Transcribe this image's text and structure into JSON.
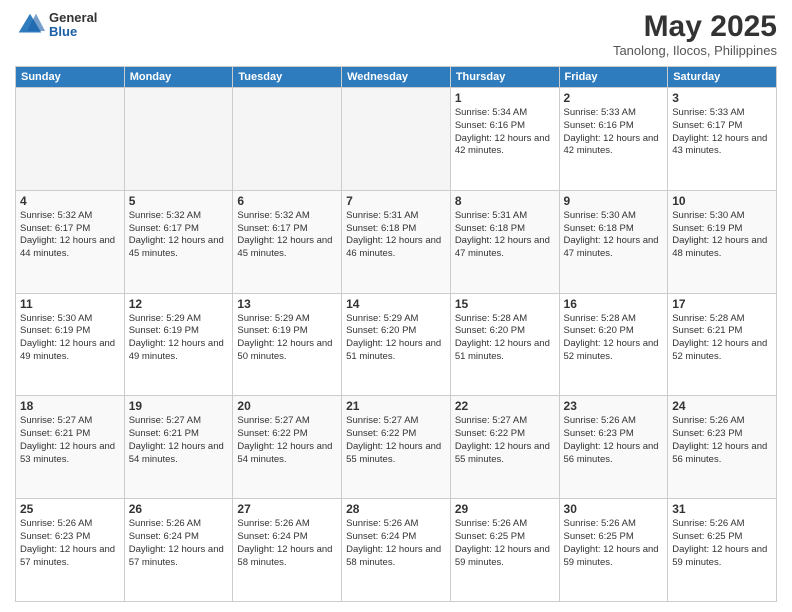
{
  "header": {
    "logo": {
      "general": "General",
      "blue": "Blue"
    },
    "title": "May 2025",
    "location": "Tanolong, Ilocos, Philippines"
  },
  "weekdays": [
    "Sunday",
    "Monday",
    "Tuesday",
    "Wednesday",
    "Thursday",
    "Friday",
    "Saturday"
  ],
  "weeks": [
    [
      {
        "day": "",
        "empty": true
      },
      {
        "day": "",
        "empty": true
      },
      {
        "day": "",
        "empty": true
      },
      {
        "day": "",
        "empty": true
      },
      {
        "day": "1",
        "sunrise": "5:34 AM",
        "sunset": "6:16 PM",
        "daylight": "12 hours and 42 minutes."
      },
      {
        "day": "2",
        "sunrise": "5:33 AM",
        "sunset": "6:16 PM",
        "daylight": "12 hours and 42 minutes."
      },
      {
        "day": "3",
        "sunrise": "5:33 AM",
        "sunset": "6:17 PM",
        "daylight": "12 hours and 43 minutes."
      }
    ],
    [
      {
        "day": "4",
        "sunrise": "5:32 AM",
        "sunset": "6:17 PM",
        "daylight": "12 hours and 44 minutes."
      },
      {
        "day": "5",
        "sunrise": "5:32 AM",
        "sunset": "6:17 PM",
        "daylight": "12 hours and 45 minutes."
      },
      {
        "day": "6",
        "sunrise": "5:32 AM",
        "sunset": "6:17 PM",
        "daylight": "12 hours and 45 minutes."
      },
      {
        "day": "7",
        "sunrise": "5:31 AM",
        "sunset": "6:18 PM",
        "daylight": "12 hours and 46 minutes."
      },
      {
        "day": "8",
        "sunrise": "5:31 AM",
        "sunset": "6:18 PM",
        "daylight": "12 hours and 47 minutes."
      },
      {
        "day": "9",
        "sunrise": "5:30 AM",
        "sunset": "6:18 PM",
        "daylight": "12 hours and 47 minutes."
      },
      {
        "day": "10",
        "sunrise": "5:30 AM",
        "sunset": "6:19 PM",
        "daylight": "12 hours and 48 minutes."
      }
    ],
    [
      {
        "day": "11",
        "sunrise": "5:30 AM",
        "sunset": "6:19 PM",
        "daylight": "12 hours and 49 minutes."
      },
      {
        "day": "12",
        "sunrise": "5:29 AM",
        "sunset": "6:19 PM",
        "daylight": "12 hours and 49 minutes."
      },
      {
        "day": "13",
        "sunrise": "5:29 AM",
        "sunset": "6:19 PM",
        "daylight": "12 hours and 50 minutes."
      },
      {
        "day": "14",
        "sunrise": "5:29 AM",
        "sunset": "6:20 PM",
        "daylight": "12 hours and 51 minutes."
      },
      {
        "day": "15",
        "sunrise": "5:28 AM",
        "sunset": "6:20 PM",
        "daylight": "12 hours and 51 minutes."
      },
      {
        "day": "16",
        "sunrise": "5:28 AM",
        "sunset": "6:20 PM",
        "daylight": "12 hours and 52 minutes."
      },
      {
        "day": "17",
        "sunrise": "5:28 AM",
        "sunset": "6:21 PM",
        "daylight": "12 hours and 52 minutes."
      }
    ],
    [
      {
        "day": "18",
        "sunrise": "5:27 AM",
        "sunset": "6:21 PM",
        "daylight": "12 hours and 53 minutes."
      },
      {
        "day": "19",
        "sunrise": "5:27 AM",
        "sunset": "6:21 PM",
        "daylight": "12 hours and 54 minutes."
      },
      {
        "day": "20",
        "sunrise": "5:27 AM",
        "sunset": "6:22 PM",
        "daylight": "12 hours and 54 minutes."
      },
      {
        "day": "21",
        "sunrise": "5:27 AM",
        "sunset": "6:22 PM",
        "daylight": "12 hours and 55 minutes."
      },
      {
        "day": "22",
        "sunrise": "5:27 AM",
        "sunset": "6:22 PM",
        "daylight": "12 hours and 55 minutes."
      },
      {
        "day": "23",
        "sunrise": "5:26 AM",
        "sunset": "6:23 PM",
        "daylight": "12 hours and 56 minutes."
      },
      {
        "day": "24",
        "sunrise": "5:26 AM",
        "sunset": "6:23 PM",
        "daylight": "12 hours and 56 minutes."
      }
    ],
    [
      {
        "day": "25",
        "sunrise": "5:26 AM",
        "sunset": "6:23 PM",
        "daylight": "12 hours and 57 minutes."
      },
      {
        "day": "26",
        "sunrise": "5:26 AM",
        "sunset": "6:24 PM",
        "daylight": "12 hours and 57 minutes."
      },
      {
        "day": "27",
        "sunrise": "5:26 AM",
        "sunset": "6:24 PM",
        "daylight": "12 hours and 58 minutes."
      },
      {
        "day": "28",
        "sunrise": "5:26 AM",
        "sunset": "6:24 PM",
        "daylight": "12 hours and 58 minutes."
      },
      {
        "day": "29",
        "sunrise": "5:26 AM",
        "sunset": "6:25 PM",
        "daylight": "12 hours and 59 minutes."
      },
      {
        "day": "30",
        "sunrise": "5:26 AM",
        "sunset": "6:25 PM",
        "daylight": "12 hours and 59 minutes."
      },
      {
        "day": "31",
        "sunrise": "5:26 AM",
        "sunset": "6:25 PM",
        "daylight": "12 hours and 59 minutes."
      }
    ]
  ]
}
